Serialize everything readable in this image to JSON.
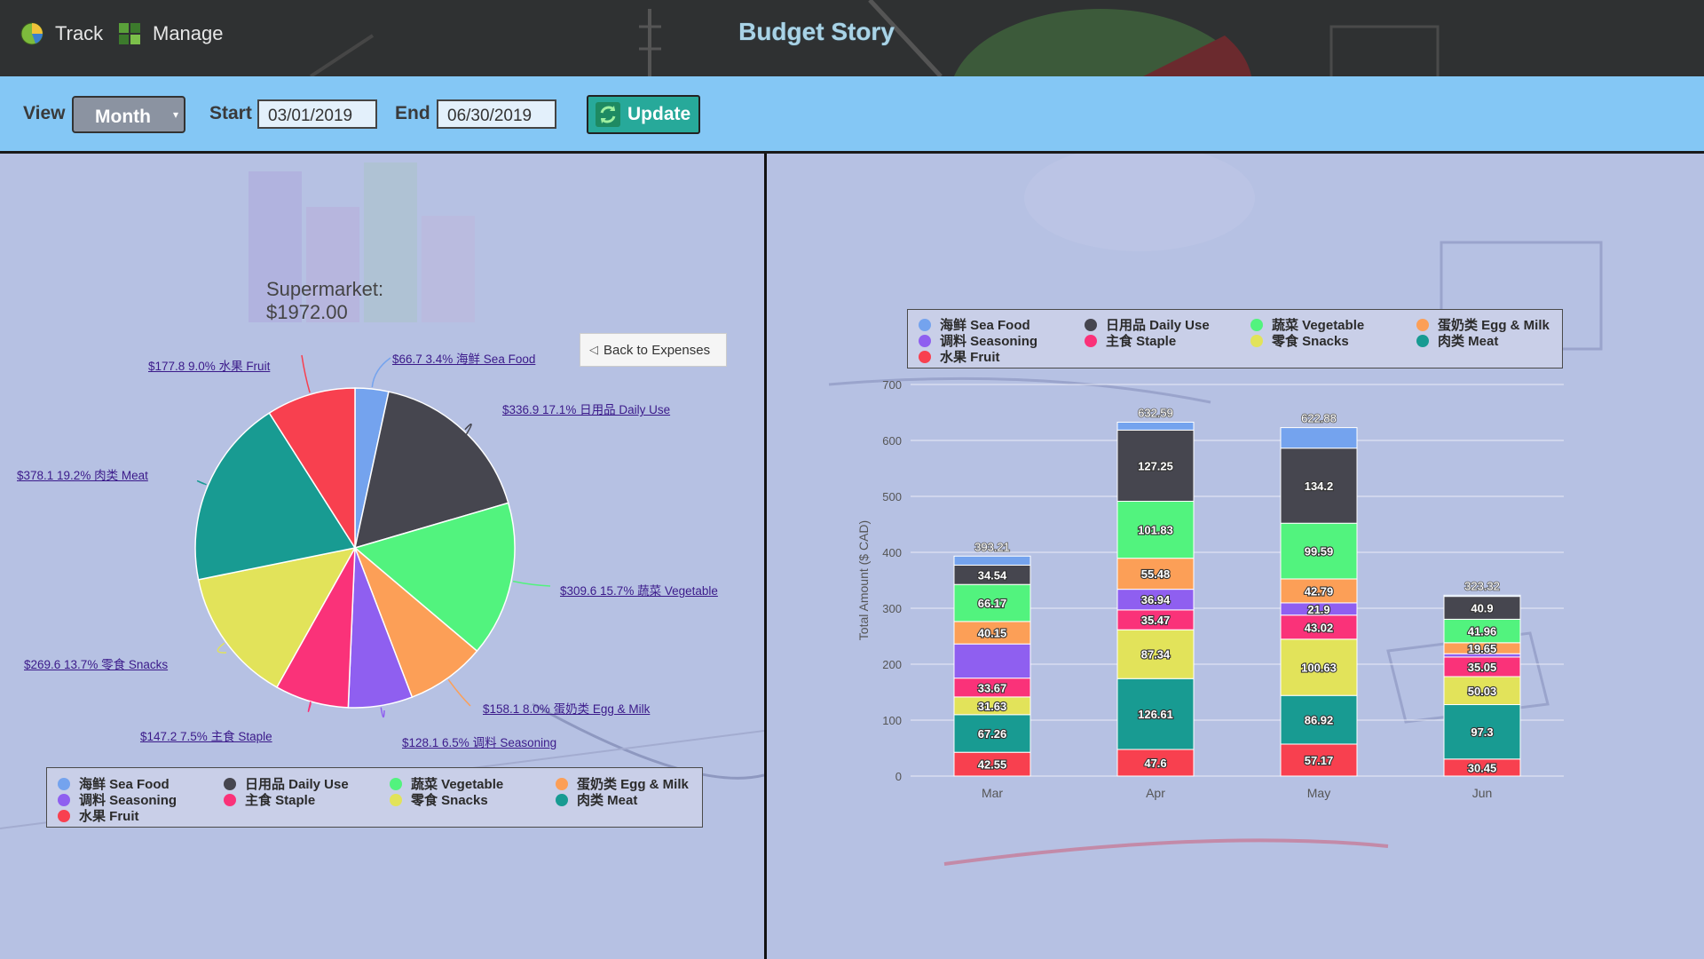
{
  "nav": {
    "track_label": "Track",
    "manage_label": "Manage",
    "app_title": "Budget Story"
  },
  "filters": {
    "view_label": "View",
    "view_value": "Month",
    "start_label": "Start",
    "start_value": "03/01/2019",
    "end_label": "End",
    "end_value": "06/30/2019",
    "update_label": "Update"
  },
  "pie": {
    "title": "Supermarket: $1972.00",
    "back_label": "Back to Expenses"
  },
  "categories": [
    {
      "name": "海鲜 Sea Food",
      "color": "#74a3ee"
    },
    {
      "name": "日用品 Daily Use",
      "color": "#46464f"
    },
    {
      "name": "蔬菜 Vegetable",
      "color": "#52f37e"
    },
    {
      "name": "蛋奶类 Egg & Milk",
      "color": "#fc9f57"
    },
    {
      "name": "调料 Seasoning",
      "color": "#8f5ff0"
    },
    {
      "name": "主食 Staple",
      "color": "#fa3279"
    },
    {
      "name": "零食 Snacks",
      "color": "#e2e35a"
    },
    {
      "name": "肉类 Meat",
      "color": "#189b92"
    },
    {
      "name": "水果 Fruit",
      "color": "#f8404f"
    }
  ],
  "chart_data": [
    {
      "type": "pie",
      "title": "Supermarket: $1972.00",
      "slices": [
        {
          "label": "$66.7 3.4% 海鲜 Sea Food",
          "category": "海鲜 Sea Food",
          "value": 66.7,
          "percent": 3.4
        },
        {
          "label": "$336.9 17.1% 日用品 Daily Use",
          "category": "日用品 Daily Use",
          "value": 336.9,
          "percent": 17.1
        },
        {
          "label": "$309.6 15.7% 蔬菜 Vegetable",
          "category": "蔬菜 Vegetable",
          "value": 309.6,
          "percent": 15.7
        },
        {
          "label": "$158.1 8.0% 蛋奶类 Egg & Milk",
          "category": "蛋奶类 Egg & Milk",
          "value": 158.1,
          "percent": 8.0
        },
        {
          "label": "$128.1 6.5% 调料 Seasoning",
          "category": "调料 Seasoning",
          "value": 128.1,
          "percent": 6.5
        },
        {
          "label": "$147.2 7.5% 主食 Staple",
          "category": "主食 Staple",
          "value": 147.2,
          "percent": 7.5
        },
        {
          "label": "$269.6 13.7% 零食 Snacks",
          "category": "零食 Snacks",
          "value": 269.6,
          "percent": 13.7
        },
        {
          "label": "$378.1 19.2% 肉类 Meat",
          "category": "肉类 Meat",
          "value": 378.1,
          "percent": 19.2
        },
        {
          "label": "$177.8 9.0% 水果 Fruit",
          "category": "水果 Fruit",
          "value": 177.8,
          "percent": 9.0
        }
      ],
      "legend": "bottom"
    },
    {
      "type": "bar",
      "stacked": true,
      "categories": [
        "Mar",
        "Apr",
        "May",
        "Jun"
      ],
      "ylabel": "Total Amount ($ CAD)",
      "xlabel": "",
      "ylim": [
        0,
        700
      ],
      "yticks": [
        0,
        100,
        200,
        300,
        400,
        500,
        600,
        700
      ],
      "totals": [
        393.21,
        632.59,
        622.88,
        323.32
      ],
      "series": [
        {
          "name": "水果 Fruit",
          "values": [
            42.55,
            47.6,
            57.17,
            30.45
          ],
          "labels": [
            "42.55",
            "47.6",
            "57.17",
            "30.45"
          ]
        },
        {
          "name": "肉类 Meat",
          "values": [
            67.26,
            126.61,
            86.92,
            97.3
          ],
          "labels": [
            "67.26",
            "126.61",
            "86.92",
            "97.3"
          ]
        },
        {
          "name": "零食 Snacks",
          "values": [
            31.63,
            87.34,
            100.63,
            50.03
          ],
          "labels": [
            "31.63",
            "87.34",
            "100.63",
            "50.03"
          ]
        },
        {
          "name": "主食 Staple",
          "values": [
            33.67,
            35.47,
            43.02,
            35.05
          ],
          "labels": [
            "33.67",
            "35.47",
            "43.02",
            "35.05"
          ]
        },
        {
          "name": "调料 Seasoning",
          "values": [
            61.1,
            36.94,
            21.9,
            5.9
          ],
          "labels": [
            "",
            "36.94",
            "21.9",
            ""
          ]
        },
        {
          "name": "蛋奶类 Egg & Milk",
          "values": [
            40.15,
            55.48,
            42.79,
            19.65
          ],
          "labels": [
            "40.15",
            "55.48",
            "42.79",
            "19.65"
          ]
        },
        {
          "name": "蔬菜 Vegetable",
          "values": [
            66.17,
            101.83,
            99.59,
            41.96
          ],
          "labels": [
            "66.17",
            "101.83",
            "99.59",
            "41.96"
          ]
        },
        {
          "name": "日用品 Daily Use",
          "values": [
            34.54,
            127.25,
            134.2,
            40.9
          ],
          "labels": [
            "34.54",
            "127.25",
            "134.2",
            "40.9"
          ]
        },
        {
          "name": "海鲜 Sea Food",
          "values": [
            16.14,
            14.07,
            36.66,
            2.08
          ],
          "labels": [
            "",
            "",
            "",
            ""
          ]
        }
      ],
      "legend": "top"
    }
  ]
}
